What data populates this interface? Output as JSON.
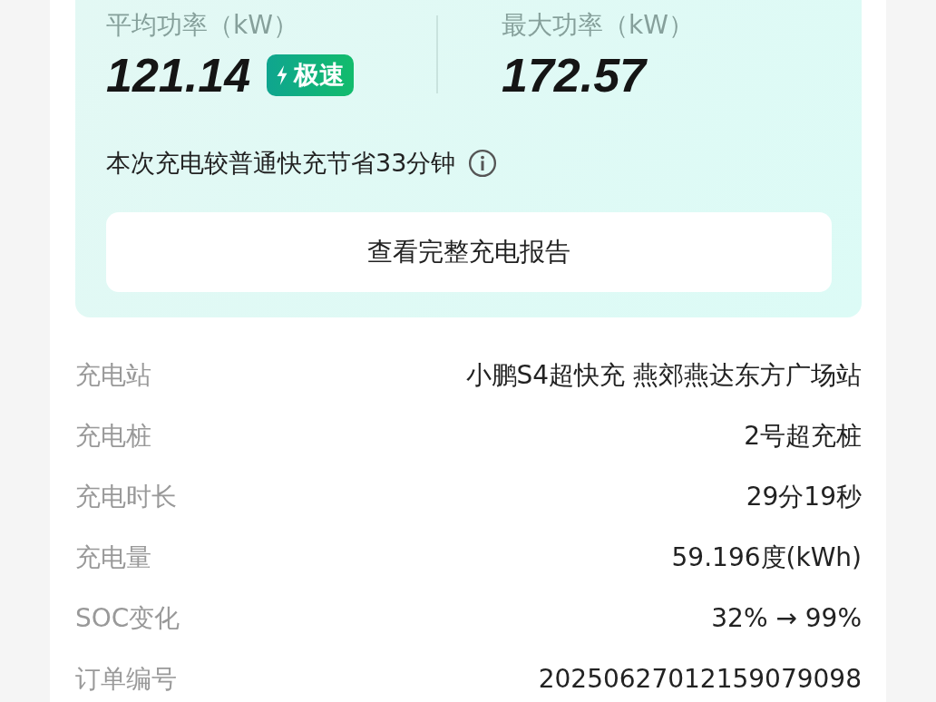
{
  "stats": [
    {
      "label": "平均功率（kW）",
      "value": "121.14",
      "badge": "极速"
    },
    {
      "label": "最大功率（kW）",
      "value": "172.57"
    }
  ],
  "savings": "本次充电较普通快充节省33分钟",
  "report_button": "查看完整充电报告",
  "details": [
    {
      "label": "充电站",
      "value": "小鹏S4超快充 燕郊燕达东方广场站"
    },
    {
      "label": "充电桩",
      "value": "2号超充桩"
    },
    {
      "label": "充电时长",
      "value": "29分19秒"
    },
    {
      "label": "充电量",
      "value": "59.196度(kWh)"
    },
    {
      "label": "SOC变化",
      "value": "32% → 99%"
    },
    {
      "label": "订单编号",
      "value": "20250627012159079098"
    }
  ]
}
